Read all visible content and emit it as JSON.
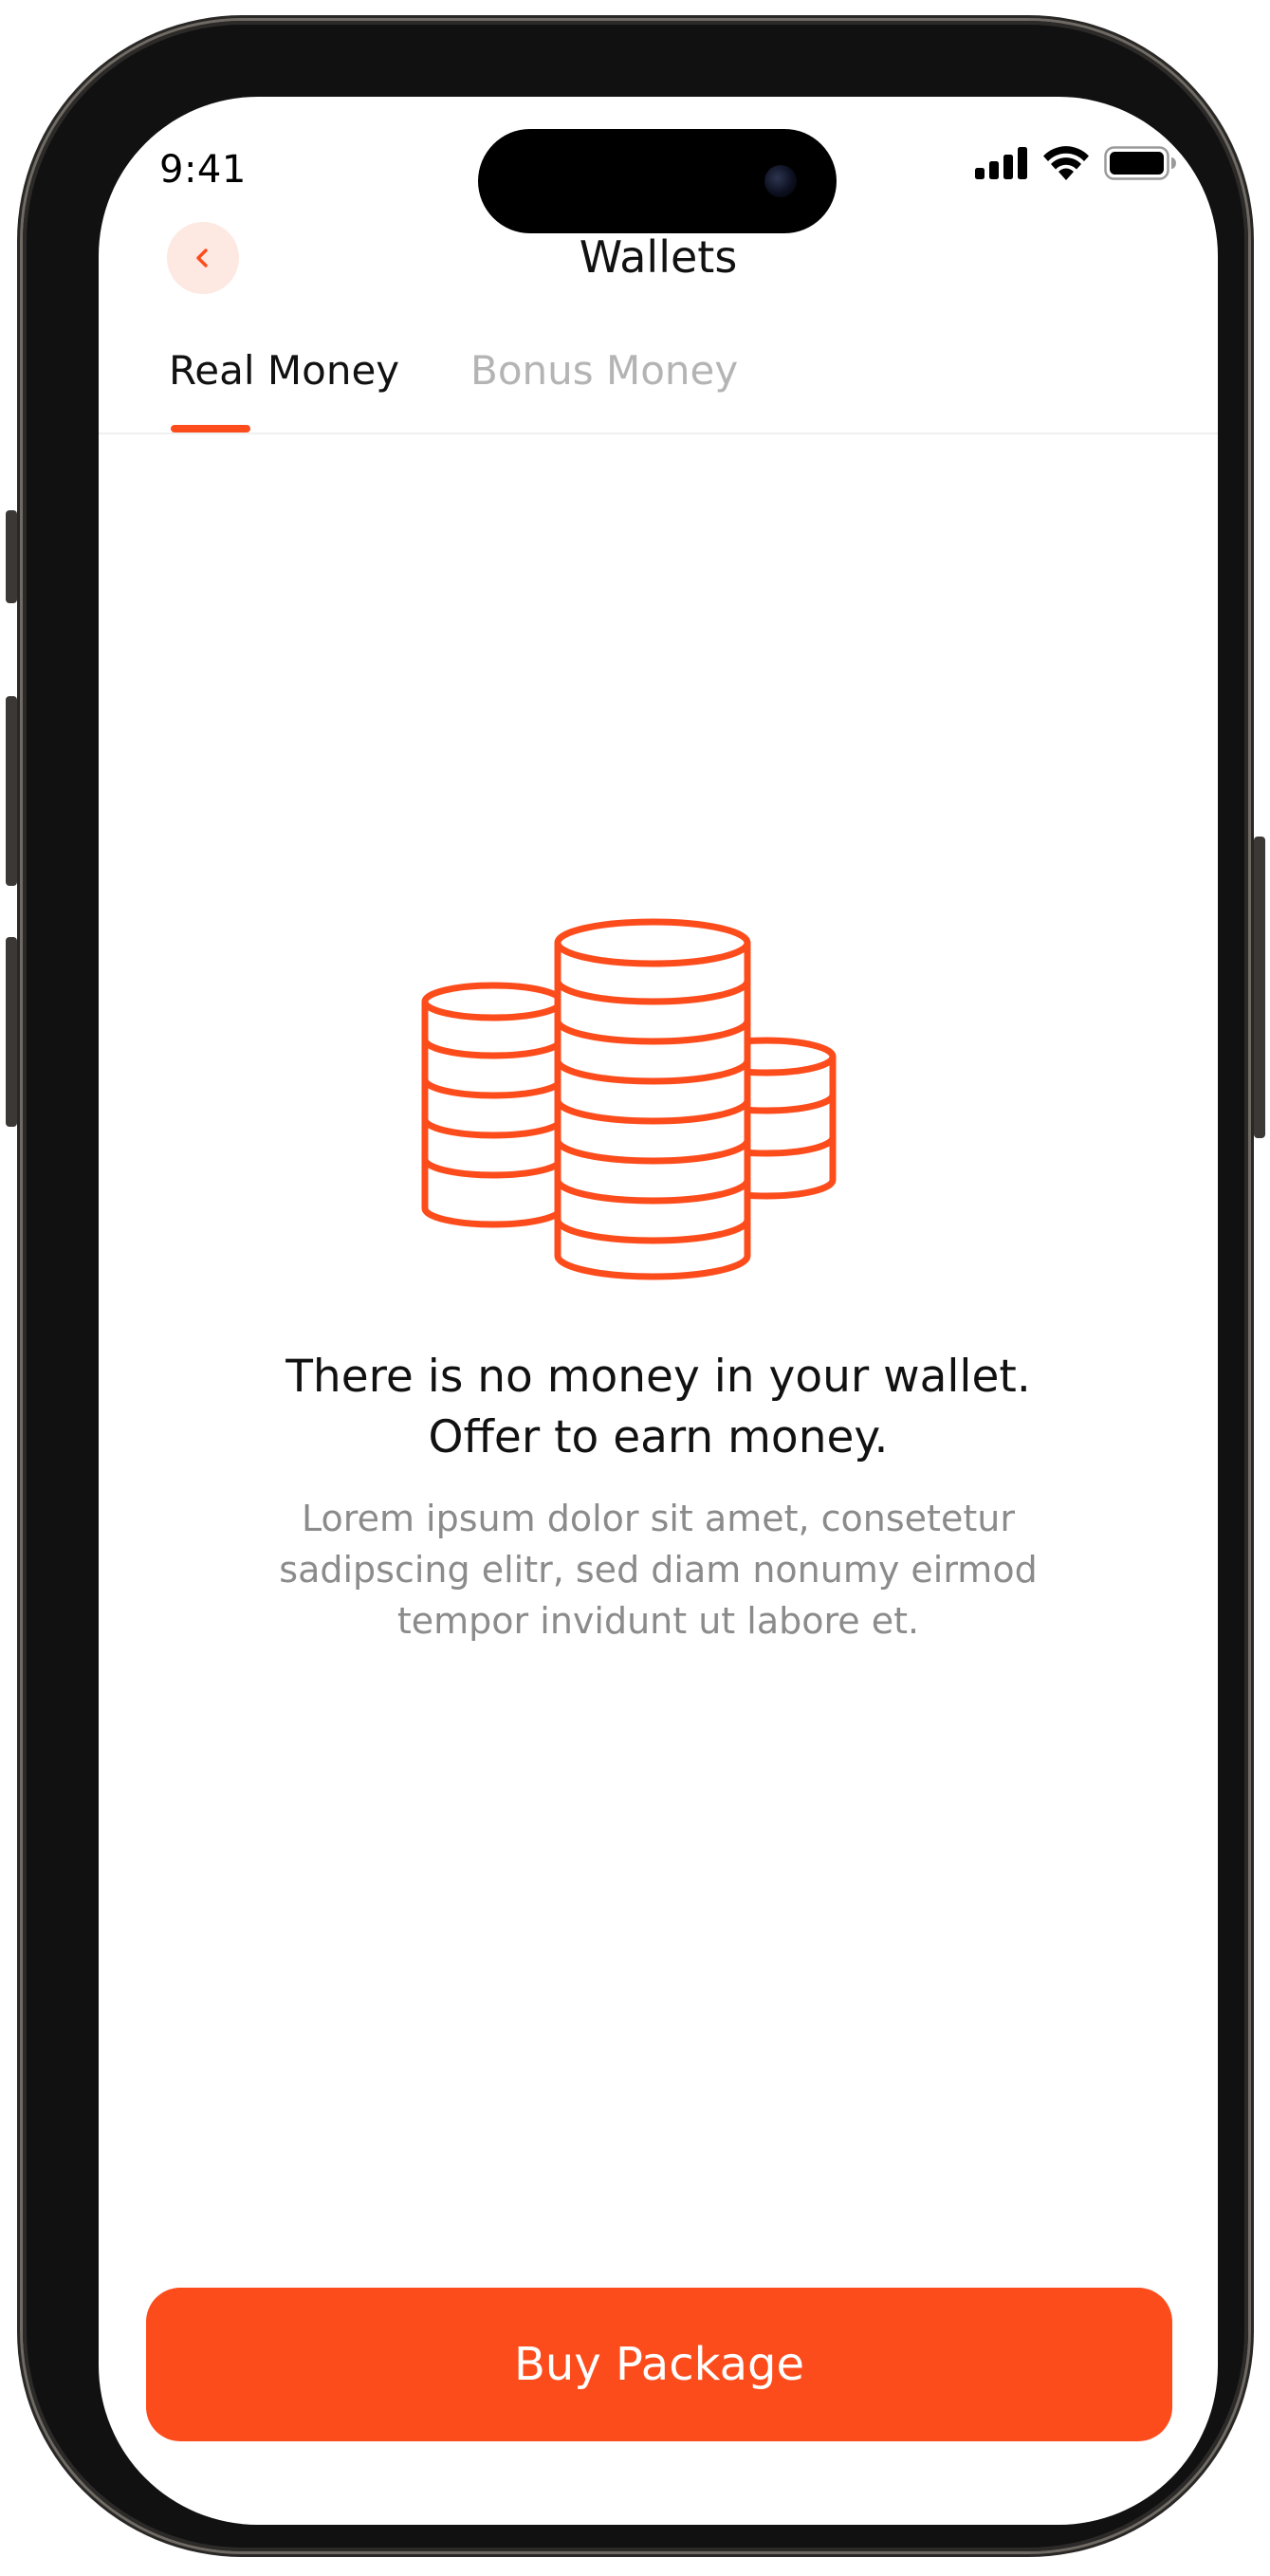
{
  "status_bar": {
    "time": "9:41",
    "icons": [
      "cellular-signal-icon",
      "wifi-icon",
      "battery-icon"
    ]
  },
  "header": {
    "title": "Wallets",
    "back_icon": "chevron-left-icon"
  },
  "tabs": [
    {
      "label": "Real Money",
      "active": true
    },
    {
      "label": "Bonus Money",
      "active": false
    }
  ],
  "empty_state": {
    "illustration": "coin-stacks-icon",
    "title_line1": "There is no money in your wallet.",
    "title_line2": "Offer to earn money.",
    "description": "Lorem ipsum dolor sit amet, consetetur sadipscing elitr, sed diam nonumy eirmod tempor invidunt ut labore et."
  },
  "cta": {
    "label": "Buy Package"
  },
  "colors": {
    "accent": "#fd4c1c",
    "accent_soft": "#fde8e2",
    "text_primary": "#111111",
    "text_secondary": "#8b8b8b",
    "tab_inactive": "#b4b4b4"
  }
}
